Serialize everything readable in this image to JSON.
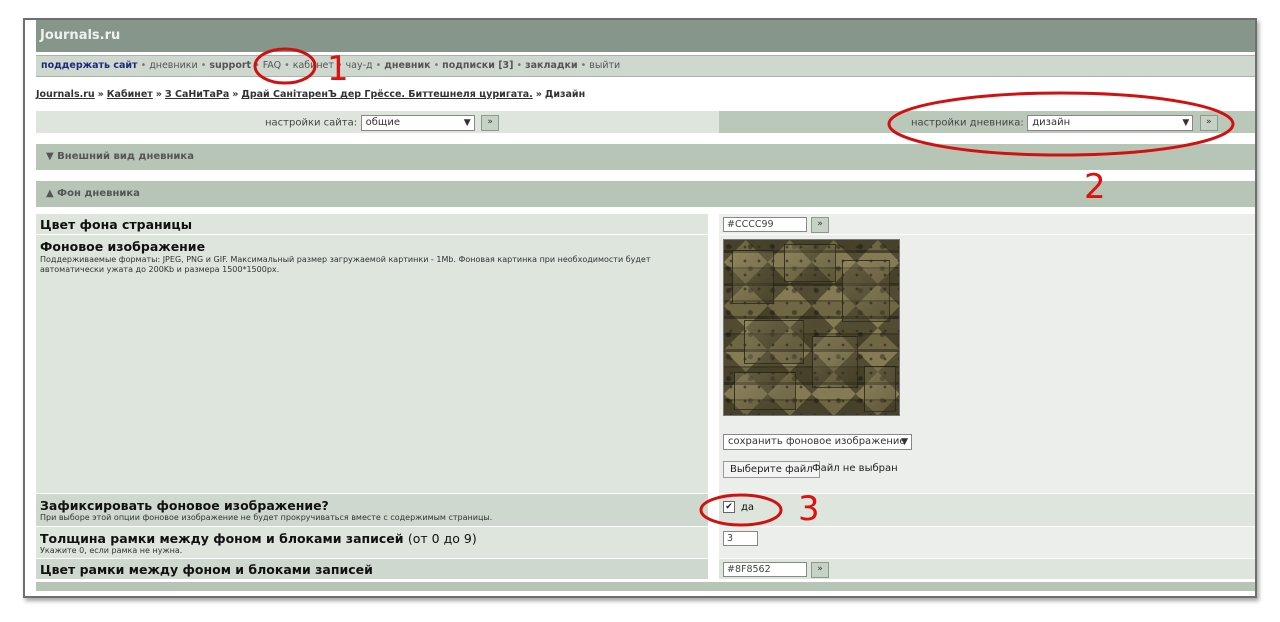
{
  "site": {
    "title": "Journals.ru"
  },
  "nav": {
    "items": [
      {
        "label": "поддержать сайт",
        "style": "first"
      },
      {
        "label": "дневники",
        "style": "plain"
      },
      {
        "label": "support",
        "style": "strong"
      },
      {
        "label": "FAQ",
        "style": "plain"
      },
      {
        "label": "кабинет",
        "style": "plain"
      },
      {
        "label": "чау-д",
        "style": "plain"
      },
      {
        "label": "дневник",
        "style": "strong"
      },
      {
        "label": "подписки [3]",
        "style": "strong"
      },
      {
        "label": "закладки",
        "style": "strong"
      },
      {
        "label": "выйти",
        "style": "plain"
      }
    ],
    "separator": "•"
  },
  "breadcrumb": {
    "items": [
      "Journals.ru",
      "Кабинет",
      "З СаНиТаРа",
      "Драй СанітаренЪ дер Грёссе. Биттешнеля цуригата."
    ],
    "separator": "»",
    "current": "Дизайн"
  },
  "settings": {
    "site_label": "настройки сайта:",
    "site_value": "общие",
    "diary_label": "настройки дневника:",
    "diary_value": "дизайн",
    "go": "»"
  },
  "sections": {
    "appearance": "▼ Внешний вид дневника",
    "background": "▲ Фон дневника"
  },
  "fields": {
    "bg_color": {
      "title": "Цвет фона страницы",
      "value": "#CCCC99",
      "go": "»"
    },
    "bg_image": {
      "title": "Фоновое изображение",
      "desc": "Поддерживаемые форматы: JPEG, PNG и GIF. Максимальный размер загружаемой картинки - 1Mb. Фоновая картинка при необходимости будет автоматически ужата до 200Kb и размера 1500*1500px.",
      "action_select": "сохранить фоновое изображение",
      "file_button": "Выберите файл",
      "file_status": "Файл не выбран"
    },
    "fix_bg": {
      "title": "Зафиксировать фоновое изображение?",
      "desc": "При выборе этой опции фоновое изображение не будет прокручиваться вместе с содержимым страницы.",
      "checked": true,
      "check_label": "да"
    },
    "border_width": {
      "title": "Толщина рамки между фоном и блоками записей",
      "title_suffix": "(от 0 до 9)",
      "desc": "Укажите 0, если рамка не нужна.",
      "value": "3"
    },
    "border_color": {
      "title": "Цвет рамки между фоном и блоками записей",
      "value": "#8F8562",
      "go": "»"
    }
  },
  "annotations": {
    "n1": "1",
    "n2": "2",
    "n3": "3",
    "color": "#d11111"
  }
}
